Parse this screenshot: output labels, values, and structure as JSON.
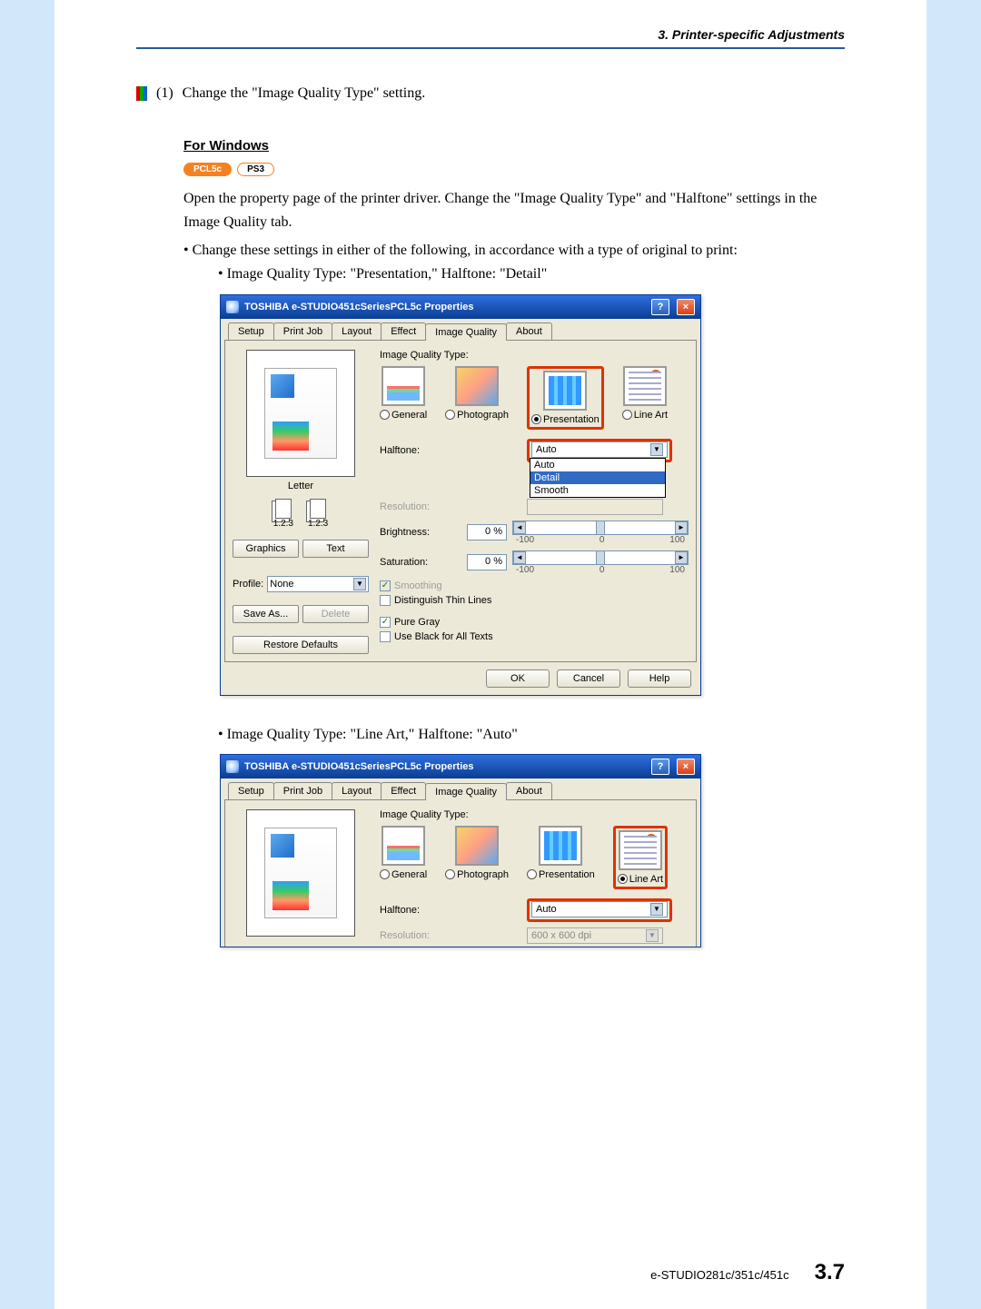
{
  "header": {
    "section_title": "3. Printer-specific Adjustments"
  },
  "step": {
    "number": "(1)",
    "text": "Change the \"Image Quality Type\" setting."
  },
  "subheading": "For Windows",
  "badges": {
    "b1": "PCL5c",
    "b2": "PS3"
  },
  "intro1": "Open the property page of the printer driver.  Change the \"Image Quality Type\" and \"Halftone\" settings in the Image Quality tab.",
  "intro2": "• Change these settings in either of the following, in accordance with a type of original to print:",
  "config1_line": "• Image Quality Type: \"Presentation,\" Halftone: \"Detail\"",
  "config2_line": "• Image Quality Type: \"Line Art,\" Halftone: \"Auto\"",
  "dialog": {
    "title": "TOSHIBA e-STUDIO451cSeriesPCL5c Properties",
    "help_btn": "?",
    "close_btn": "×",
    "tabs": {
      "setup": "Setup",
      "printjob": "Print Job",
      "layout": "Layout",
      "effect": "Effect",
      "image_quality": "Image Quality",
      "about": "About"
    },
    "left": {
      "preview_label": "Letter",
      "thumb_label": "1.2.3",
      "graphics_btn": "Graphics",
      "text_btn": "Text",
      "profile_label": "Profile:",
      "profile_value": "None",
      "save_as_btn": "Save As...",
      "delete_btn": "Delete",
      "restore_btn": "Restore Defaults"
    },
    "right": {
      "iqt_label": "Image Quality Type:",
      "general": "General",
      "photograph": "Photograph",
      "presentation": "Presentation",
      "lineart": "Line Art",
      "halftone_label": "Halftone:",
      "halftone_value": "Auto",
      "halftone_options": {
        "o1": "Auto",
        "o2": "Detail",
        "o3": "Smooth"
      },
      "resolution_label": "Resolution:",
      "resolution_value": "600 x 600 dpi",
      "brightness_label": "Brightness:",
      "brightness_value": "0 %",
      "saturation_label": "Saturation:",
      "saturation_value": "0 %",
      "scale_min": "-100",
      "scale_mid": "0",
      "scale_max": "100",
      "smoothing": "Smoothing",
      "thinlines": "Distinguish Thin Lines",
      "puregray": "Pure Gray",
      "blacktexts": "Use Black for All Texts"
    },
    "actions": {
      "ok": "OK",
      "cancel": "Cancel",
      "help": "Help"
    }
  },
  "footer": {
    "model": "e-STUDIO281c/351c/451c",
    "page": "3.7"
  }
}
